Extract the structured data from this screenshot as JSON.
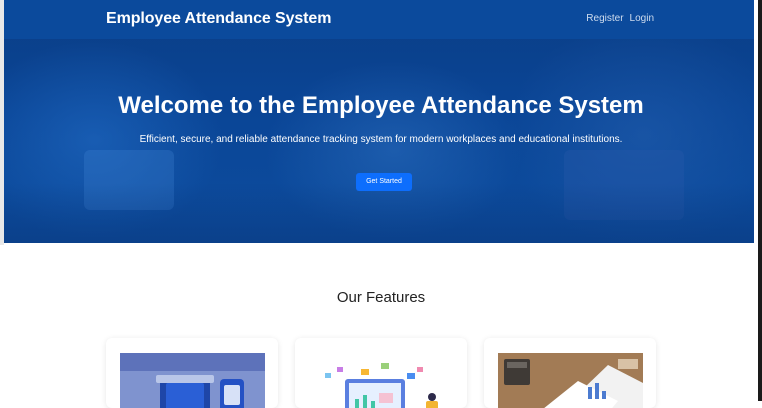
{
  "navbar": {
    "brand": "Employee Attendance System",
    "links": [
      "Register",
      "Login"
    ]
  },
  "hero": {
    "title": "Welcome to the Employee Attendance System",
    "subtitle": "Efficient, secure, and reliable attendance tracking system for modern workplaces and educational institutions.",
    "cta_label": "Get Started"
  },
  "features": {
    "title": "Our Features",
    "cards": [
      {
        "image": "biometric-device-image"
      },
      {
        "image": "dashboard-illustration-image"
      },
      {
        "image": "desk-reports-image"
      }
    ]
  },
  "colors": {
    "primary": "#0d6efd",
    "hero_bg": "#0b4a9c"
  }
}
